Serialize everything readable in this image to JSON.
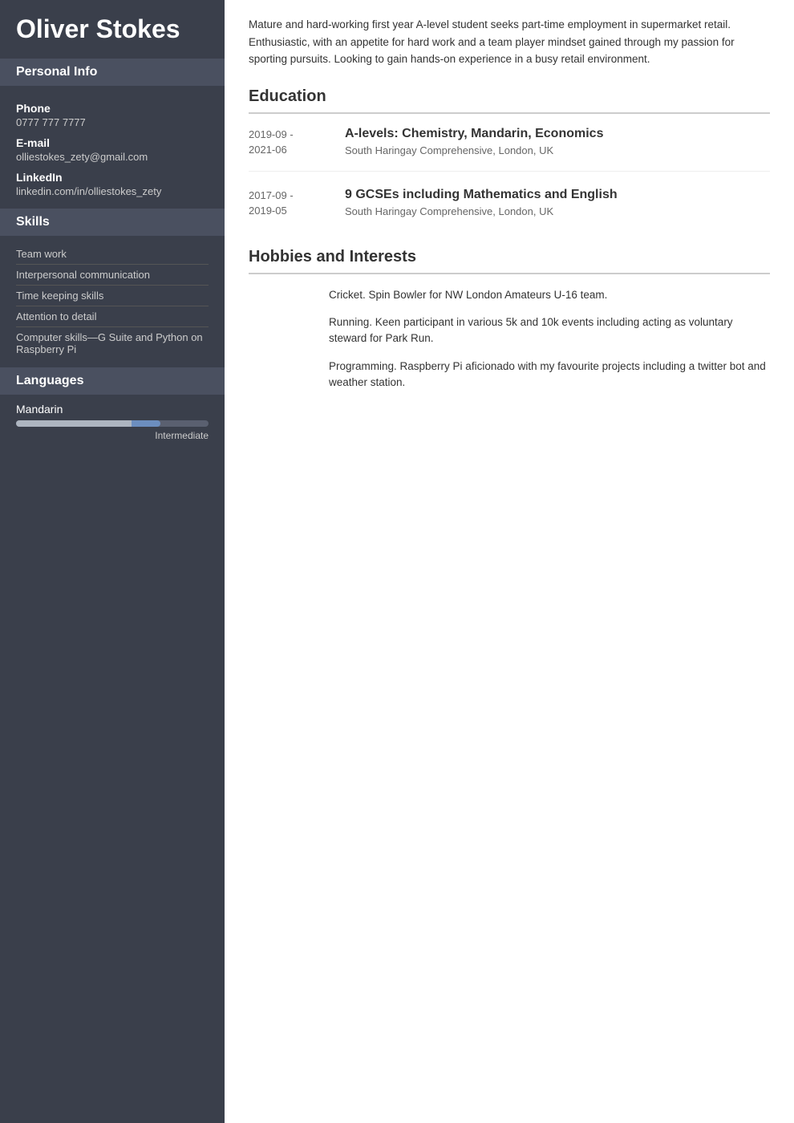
{
  "sidebar": {
    "name": "Oliver Stokes",
    "personal_info": {
      "header": "Personal Info",
      "phone_label": "Phone",
      "phone_value": "0777 777 7777",
      "email_label": "E-mail",
      "email_value": "olliestokes_zety@gmail.com",
      "linkedin_label": "LinkedIn",
      "linkedin_value": "linkedin.com/in/olliestokes_zety"
    },
    "skills": {
      "header": "Skills",
      "items": [
        "Team work",
        "Interpersonal communication",
        "Time keeping skills",
        "Attention to detail",
        "Computer skills—G Suite and Python on Raspberry Pi"
      ]
    },
    "languages": {
      "header": "Languages",
      "items": [
        {
          "name": "Mandarin",
          "level": "Intermediate",
          "bar_filled_pct": 60,
          "bar_accent_pct": 15
        }
      ]
    }
  },
  "main": {
    "summary": "Mature and hard-working first year A-level student seeks part-time employment in supermarket retail. Enthusiastic, with an appetite for hard work and a team player mindset gained through my passion for sporting pursuits. Looking to gain hands-on experience in a busy retail environment.",
    "education": {
      "header": "Education",
      "entries": [
        {
          "dates": "2019-09 - 2021-06",
          "degree": "A-levels: Chemistry, Mandarin, Economics",
          "school": "South Haringay Comprehensive, London, UK"
        },
        {
          "dates": "2017-09 - 2019-05",
          "degree": "9 GCSEs including Mathematics and English",
          "school": "South Haringay Comprehensive, London, UK"
        }
      ]
    },
    "hobbies": {
      "header": "Hobbies and Interests",
      "items": [
        "Cricket. Spin Bowler for NW London Amateurs U-16 team.",
        "Running. Keen participant in various 5k and 10k events including acting as voluntary steward for Park Run.",
        "Programming. Raspberry Pi aficionado with my favourite projects including a twitter bot and weather station."
      ]
    }
  }
}
